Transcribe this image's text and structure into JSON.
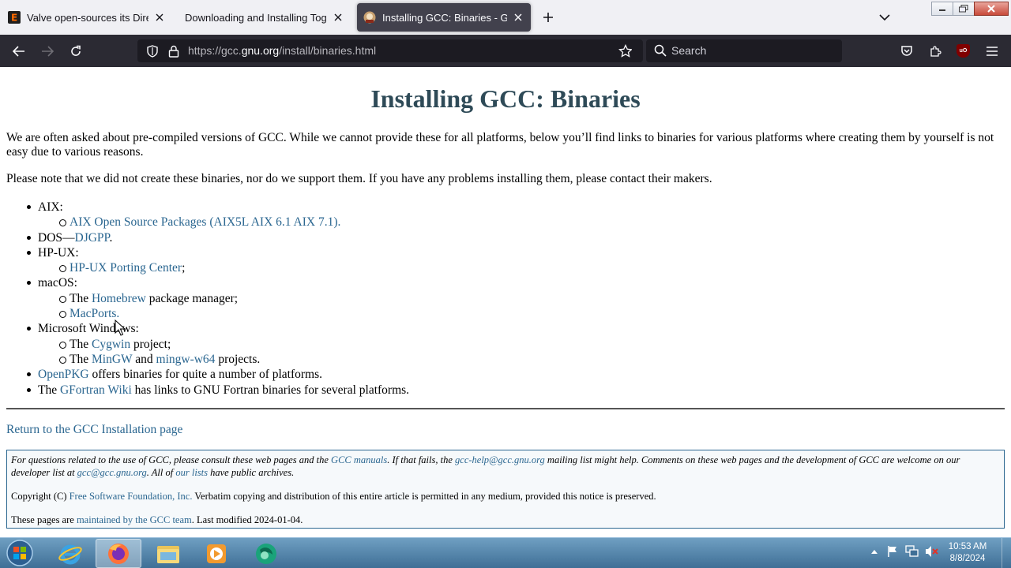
{
  "browser": {
    "tabs": [
      {
        "title": "Valve open-sources its DirectX t",
        "favicon": "engadget-icon",
        "active": false
      },
      {
        "title": "Downloading and Installing Togl",
        "favicon": "none",
        "active": false
      },
      {
        "title": "Installing GCC: Binaries - GNU P",
        "favicon": "gnu-gcc-icon",
        "active": true
      }
    ],
    "url": {
      "prefix": "https://gcc.",
      "host": "gnu.org",
      "path": "/install/binaries.html"
    },
    "search_placeholder": "Search",
    "ublock_badge": "uO"
  },
  "page": {
    "title": "Installing GCC: Binaries",
    "intro": "We are often asked about pre-compiled versions of GCC. While we cannot provide these for all platforms, below you’ll find links to binaries for various platforms where creating them by yourself is not easy due to various reasons.",
    "note": "Please note that we did not create these binaries, nor do we support them. If you have any problems installing them, please contact their makers.",
    "list": {
      "aix": {
        "label": "AIX:",
        "link": "AIX Open Source Packages (AIX5L AIX 6.1 AIX 7.1)."
      },
      "dos": {
        "label": "DOS—",
        "link": "DJGPP",
        "suffix": "."
      },
      "hpux": {
        "label": "HP-UX:",
        "link": "HP-UX Porting Center",
        "suffix": ";"
      },
      "macos": {
        "label": "macOS:",
        "homebrew_pre": "The ",
        "homebrew": "Homebrew",
        "homebrew_post": " package manager;",
        "macports": "MacPorts."
      },
      "windows": {
        "label": "Microsoft Windows:",
        "cygwin_pre": "The ",
        "cygwin": "Cygwin",
        "cygwin_post": " project;",
        "mingw_pre": "The ",
        "mingw": "MinGW",
        "and": " and ",
        "mingw64": "mingw-w64",
        "mingw_post": " projects."
      },
      "openpkg": {
        "link": "OpenPKG",
        "text": " offers binaries for quite a number of platforms."
      },
      "gfortran": {
        "pre": "The ",
        "link": "GFortran Wiki",
        "text": " has links to GNU Fortran binaries for several platforms."
      }
    },
    "return_link": "Return to the GCC Installation page",
    "footer": {
      "q1": "For questions related to the use of GCC, please consult these web pages and the ",
      "gcc_manuals": "GCC manuals",
      "q2": ". If that fails, the ",
      "gcc_help": "gcc-help@gcc.gnu.org",
      "q3": " mailing list might help. Comments on these web pages and the development of GCC are welcome on our developer list at ",
      "gcc_list": "gcc@gcc.gnu.org",
      "q4": ". All of ",
      "our_lists": "our lists",
      "q5": " have public archives.",
      "copyright_pre": "Copyright (C) ",
      "fsf": "Free Software Foundation, Inc.",
      "copyright_post": " Verbatim copying and distribution of this entire article is permitted in any medium, provided this notice is preserved.",
      "maintained_pre": "These pages are ",
      "maintained": "maintained by the GCC team",
      "maintained_post": ". Last modified 2024-01-04."
    }
  },
  "taskbar": {
    "apps": [
      "internet-explorer-icon",
      "firefox-icon",
      "file-explorer-icon",
      "media-player-icon",
      "app-icon"
    ],
    "clock_time": "10:53 AM",
    "clock_date": "8/8/2024"
  },
  "colors": {
    "link": "#2a6690",
    "heading": "#2e4a57",
    "tab_active": "#42414d",
    "navbar": "#2b2a33"
  }
}
